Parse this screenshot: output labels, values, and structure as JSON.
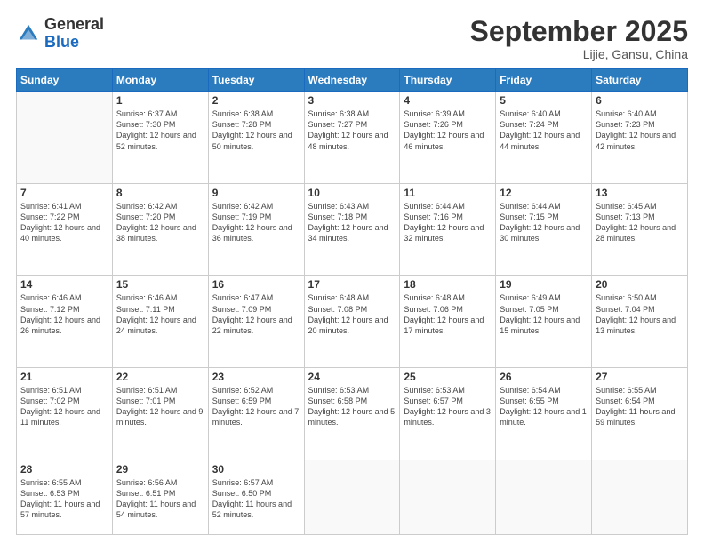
{
  "logo": {
    "general": "General",
    "blue": "Blue"
  },
  "header": {
    "title": "September 2025",
    "subtitle": "Lijie, Gansu, China"
  },
  "days_of_week": [
    "Sunday",
    "Monday",
    "Tuesday",
    "Wednesday",
    "Thursday",
    "Friday",
    "Saturday"
  ],
  "weeks": [
    [
      {
        "day": "",
        "sunrise": "",
        "sunset": "",
        "daylight": ""
      },
      {
        "day": "1",
        "sunrise": "Sunrise: 6:37 AM",
        "sunset": "Sunset: 7:30 PM",
        "daylight": "Daylight: 12 hours and 52 minutes."
      },
      {
        "day": "2",
        "sunrise": "Sunrise: 6:38 AM",
        "sunset": "Sunset: 7:28 PM",
        "daylight": "Daylight: 12 hours and 50 minutes."
      },
      {
        "day": "3",
        "sunrise": "Sunrise: 6:38 AM",
        "sunset": "Sunset: 7:27 PM",
        "daylight": "Daylight: 12 hours and 48 minutes."
      },
      {
        "day": "4",
        "sunrise": "Sunrise: 6:39 AM",
        "sunset": "Sunset: 7:26 PM",
        "daylight": "Daylight: 12 hours and 46 minutes."
      },
      {
        "day": "5",
        "sunrise": "Sunrise: 6:40 AM",
        "sunset": "Sunset: 7:24 PM",
        "daylight": "Daylight: 12 hours and 44 minutes."
      },
      {
        "day": "6",
        "sunrise": "Sunrise: 6:40 AM",
        "sunset": "Sunset: 7:23 PM",
        "daylight": "Daylight: 12 hours and 42 minutes."
      }
    ],
    [
      {
        "day": "7",
        "sunrise": "Sunrise: 6:41 AM",
        "sunset": "Sunset: 7:22 PM",
        "daylight": "Daylight: 12 hours and 40 minutes."
      },
      {
        "day": "8",
        "sunrise": "Sunrise: 6:42 AM",
        "sunset": "Sunset: 7:20 PM",
        "daylight": "Daylight: 12 hours and 38 minutes."
      },
      {
        "day": "9",
        "sunrise": "Sunrise: 6:42 AM",
        "sunset": "Sunset: 7:19 PM",
        "daylight": "Daylight: 12 hours and 36 minutes."
      },
      {
        "day": "10",
        "sunrise": "Sunrise: 6:43 AM",
        "sunset": "Sunset: 7:18 PM",
        "daylight": "Daylight: 12 hours and 34 minutes."
      },
      {
        "day": "11",
        "sunrise": "Sunrise: 6:44 AM",
        "sunset": "Sunset: 7:16 PM",
        "daylight": "Daylight: 12 hours and 32 minutes."
      },
      {
        "day": "12",
        "sunrise": "Sunrise: 6:44 AM",
        "sunset": "Sunset: 7:15 PM",
        "daylight": "Daylight: 12 hours and 30 minutes."
      },
      {
        "day": "13",
        "sunrise": "Sunrise: 6:45 AM",
        "sunset": "Sunset: 7:13 PM",
        "daylight": "Daylight: 12 hours and 28 minutes."
      }
    ],
    [
      {
        "day": "14",
        "sunrise": "Sunrise: 6:46 AM",
        "sunset": "Sunset: 7:12 PM",
        "daylight": "Daylight: 12 hours and 26 minutes."
      },
      {
        "day": "15",
        "sunrise": "Sunrise: 6:46 AM",
        "sunset": "Sunset: 7:11 PM",
        "daylight": "Daylight: 12 hours and 24 minutes."
      },
      {
        "day": "16",
        "sunrise": "Sunrise: 6:47 AM",
        "sunset": "Sunset: 7:09 PM",
        "daylight": "Daylight: 12 hours and 22 minutes."
      },
      {
        "day": "17",
        "sunrise": "Sunrise: 6:48 AM",
        "sunset": "Sunset: 7:08 PM",
        "daylight": "Daylight: 12 hours and 20 minutes."
      },
      {
        "day": "18",
        "sunrise": "Sunrise: 6:48 AM",
        "sunset": "Sunset: 7:06 PM",
        "daylight": "Daylight: 12 hours and 17 minutes."
      },
      {
        "day": "19",
        "sunrise": "Sunrise: 6:49 AM",
        "sunset": "Sunset: 7:05 PM",
        "daylight": "Daylight: 12 hours and 15 minutes."
      },
      {
        "day": "20",
        "sunrise": "Sunrise: 6:50 AM",
        "sunset": "Sunset: 7:04 PM",
        "daylight": "Daylight: 12 hours and 13 minutes."
      }
    ],
    [
      {
        "day": "21",
        "sunrise": "Sunrise: 6:51 AM",
        "sunset": "Sunset: 7:02 PM",
        "daylight": "Daylight: 12 hours and 11 minutes."
      },
      {
        "day": "22",
        "sunrise": "Sunrise: 6:51 AM",
        "sunset": "Sunset: 7:01 PM",
        "daylight": "Daylight: 12 hours and 9 minutes."
      },
      {
        "day": "23",
        "sunrise": "Sunrise: 6:52 AM",
        "sunset": "Sunset: 6:59 PM",
        "daylight": "Daylight: 12 hours and 7 minutes."
      },
      {
        "day": "24",
        "sunrise": "Sunrise: 6:53 AM",
        "sunset": "Sunset: 6:58 PM",
        "daylight": "Daylight: 12 hours and 5 minutes."
      },
      {
        "day": "25",
        "sunrise": "Sunrise: 6:53 AM",
        "sunset": "Sunset: 6:57 PM",
        "daylight": "Daylight: 12 hours and 3 minutes."
      },
      {
        "day": "26",
        "sunrise": "Sunrise: 6:54 AM",
        "sunset": "Sunset: 6:55 PM",
        "daylight": "Daylight: 12 hours and 1 minute."
      },
      {
        "day": "27",
        "sunrise": "Sunrise: 6:55 AM",
        "sunset": "Sunset: 6:54 PM",
        "daylight": "Daylight: 11 hours and 59 minutes."
      }
    ],
    [
      {
        "day": "28",
        "sunrise": "Sunrise: 6:55 AM",
        "sunset": "Sunset: 6:53 PM",
        "daylight": "Daylight: 11 hours and 57 minutes."
      },
      {
        "day": "29",
        "sunrise": "Sunrise: 6:56 AM",
        "sunset": "Sunset: 6:51 PM",
        "daylight": "Daylight: 11 hours and 54 minutes."
      },
      {
        "day": "30",
        "sunrise": "Sunrise: 6:57 AM",
        "sunset": "Sunset: 6:50 PM",
        "daylight": "Daylight: 11 hours and 52 minutes."
      },
      {
        "day": "",
        "sunrise": "",
        "sunset": "",
        "daylight": ""
      },
      {
        "day": "",
        "sunrise": "",
        "sunset": "",
        "daylight": ""
      },
      {
        "day": "",
        "sunrise": "",
        "sunset": "",
        "daylight": ""
      },
      {
        "day": "",
        "sunrise": "",
        "sunset": "",
        "daylight": ""
      }
    ]
  ]
}
